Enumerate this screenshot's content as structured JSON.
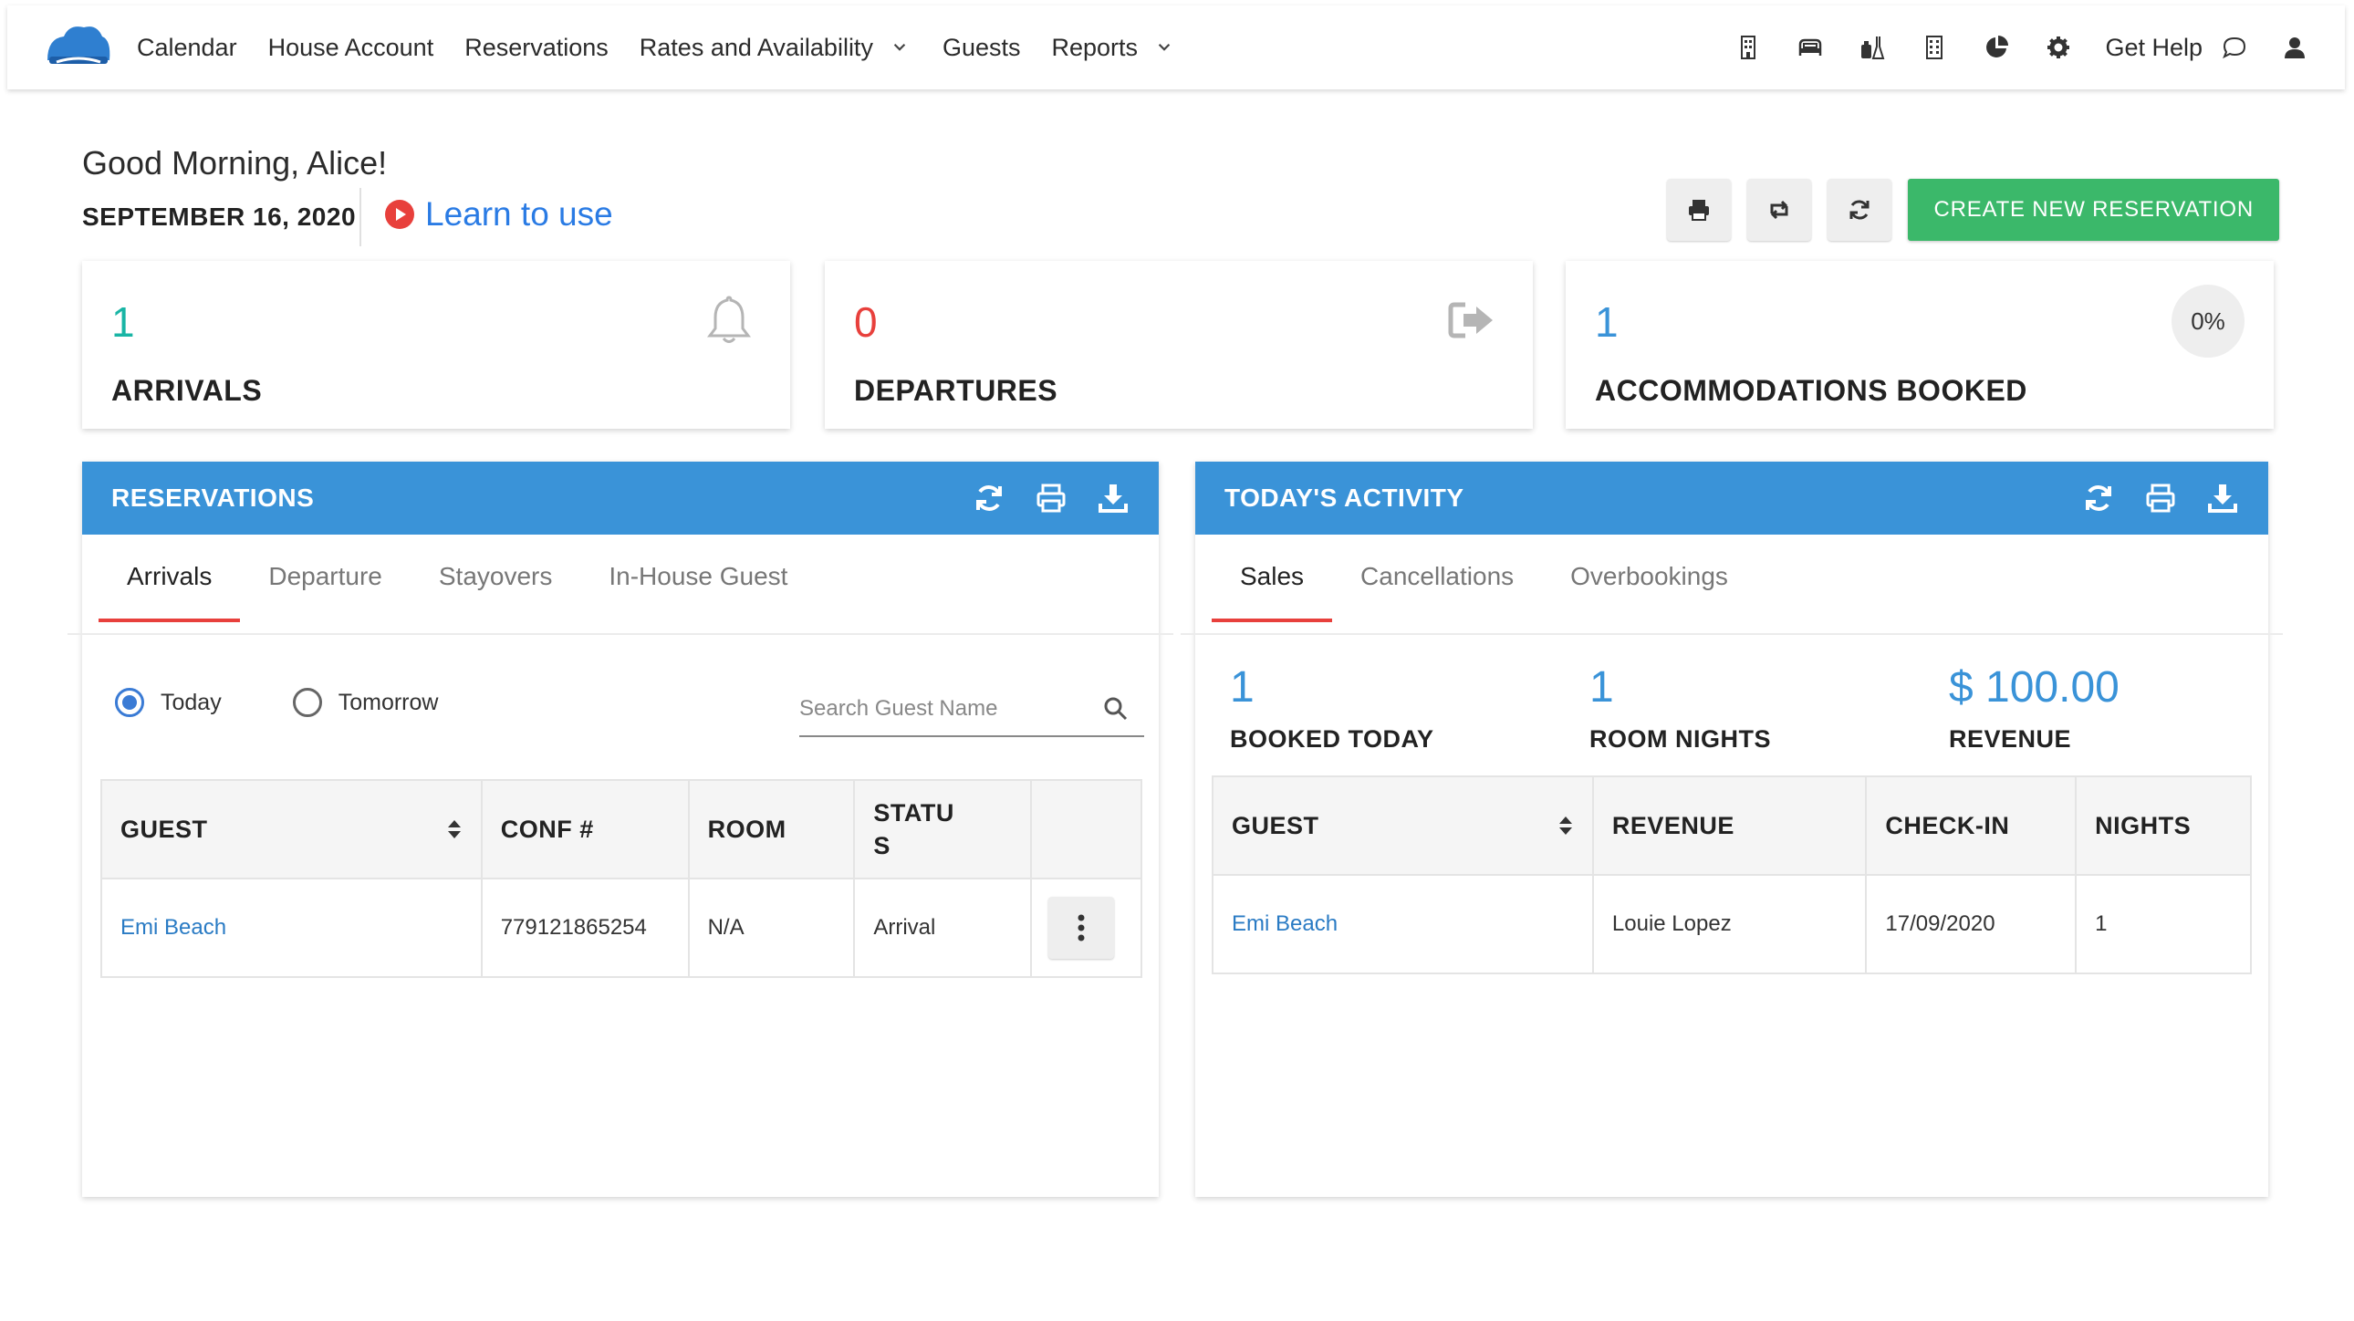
{
  "nav": {
    "items": [
      {
        "label": "Calendar"
      },
      {
        "label": "House Account"
      },
      {
        "label": "Reservations"
      },
      {
        "label": "Rates and Availability"
      },
      {
        "label": "Guests"
      },
      {
        "label": "Reports"
      }
    ],
    "help_label": "Get Help",
    "icons": [
      "building-icon",
      "bed-icon",
      "housekeeping-icon",
      "building-alt-icon",
      "pie-chart-icon",
      "gear-icon",
      "chat-icon",
      "user-icon"
    ]
  },
  "header": {
    "greeting": "Good Morning, Alice!",
    "date": "SEPTEMBER 16, 2020",
    "learn_label": "Learn to use",
    "create_label": "CREATE NEW RESERVATION"
  },
  "stats": {
    "arrivals": {
      "value": "1",
      "label": "ARRIVALS",
      "color": "#19b5a5"
    },
    "departures": {
      "value": "0",
      "label": "DEPARTURES",
      "color": "#e8403c"
    },
    "accommodations": {
      "value": "1",
      "label": "ACCOMMODATIONS BOOKED",
      "badge": "0%",
      "color": "#3a93d8"
    }
  },
  "reservations": {
    "title": "RESERVATIONS",
    "tabs": [
      {
        "label": "Arrivals"
      },
      {
        "label": "Departure"
      },
      {
        "label": "Stayovers"
      },
      {
        "label": "In-House Guest"
      }
    ],
    "radios": [
      {
        "label": "Today",
        "selected": true
      },
      {
        "label": "Tomorrow",
        "selected": false
      }
    ],
    "search_placeholder": "Search Guest Name",
    "columns": [
      "GUEST",
      "CONF #",
      "ROOM",
      "STATU\nS"
    ],
    "rows": [
      {
        "guest": "Emi Beach",
        "conf": "779121865254",
        "room": "N/A",
        "status": "Arrival"
      }
    ]
  },
  "activity": {
    "title": "TODAY'S ACTIVITY",
    "tabs": [
      {
        "label": "Sales"
      },
      {
        "label": "Cancellations"
      },
      {
        "label": "Overbookings"
      }
    ],
    "metrics": [
      {
        "value": "1",
        "label": "BOOKED TODAY"
      },
      {
        "value": "1",
        "label": "ROOM NIGHTS"
      },
      {
        "value": "$ 100.00",
        "label": "REVENUE"
      }
    ],
    "columns": [
      "GUEST",
      "REVENUE",
      "CHECK-IN",
      "NIGHTS"
    ],
    "rows": [
      {
        "guest": "Emi Beach",
        "revenue": "Louie Lopez",
        "checkin": "17/09/2020",
        "nights": "1"
      }
    ]
  },
  "colors": {
    "primary": "#3a93d8",
    "accent_green": "#3bb86a",
    "accent_red": "#e8403c",
    "teal": "#19b5a5"
  }
}
